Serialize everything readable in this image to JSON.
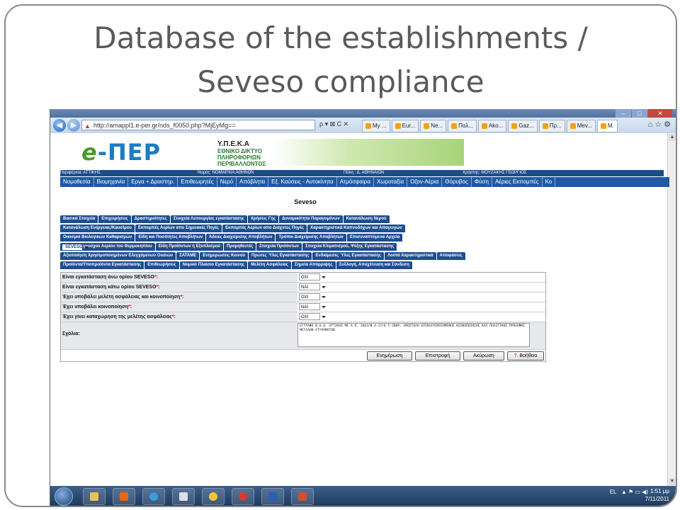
{
  "slide": {
    "title_line1": "Database of the establishments /",
    "title_line2": "Seveso compliance"
  },
  "browser": {
    "url": "http://amappl1.e-per.gr/nds_f0050.php?MjEyMg==",
    "tools": "ρ ▾ ⊠ C ✕",
    "tabs": [
      "My ...",
      "Eur...",
      "Ne...",
      "Πολ...",
      "Ako...",
      "Gaz...",
      "Πρ...",
      "Mev...",
      "M."
    ],
    "right_icons": "⌂ ☆ ⚙"
  },
  "site": {
    "logo_prefix": "e",
    "logo_text": "-ΠΕΡ",
    "org_name": "Υ.Π.Ε.Κ.Α",
    "org_line1": "ΕΘΝΙΚΟ ΔΙΚΤΥΟ",
    "org_line2": "ΠΛΗΡΟΦΟΡΙΩΝ",
    "org_line3": "ΠΕΡΙΒΑΛΛΟΝΤΟΣ",
    "info": {
      "region": "Περιφέρεια: ΑΤΤΙΚΗΣ",
      "prefecture": "Νομός: ΝΟΜΑΡΧΙΑ ΑΘΗΝΩΝ",
      "city": "Πόλη : Δ. ΑΘΗΝΑΙΩΝ",
      "user": "Χρήστης: ΜΟΥΖΑΚΗΣ ΓΕΩΡΓΙΟΣ"
    },
    "menu": [
      "Νομοθεσία",
      "Βιομηχανία",
      "Εργα + Δραστηρ.",
      "Επιθεωρητές",
      "Νερό",
      "Απόβλητα",
      "Εξ. Καύσεις - Αυτοκίνητα",
      "Ατμόσφαιρα",
      "Χωροταξία",
      "Οζον-Αέρια",
      "Θόρυβος",
      "Φύση",
      "Αέριες Εκπομπές",
      "Κο"
    ]
  },
  "page": {
    "heading": "Seveso",
    "tab_rows": [
      [
        "Βασικά Στοιχεία",
        "Επιχειρήσεις",
        "Δραστηριότητες",
        "Στοιχεία Λειτουργίας εγκατάστασης",
        "Χρήσεις Γης",
        "Δυναμικότητα Παραγομένων",
        "Κατανάλωση Νερού"
      ],
      [
        "Κατανάλωση Ενέργειας/Καυσίμου",
        "Εκπομπές Αερίων απο Σημειακές Πηγές",
        "Εκπομπές Αερίων απο Διάχυτες Πηγές",
        "Χαρακτηριστικά Καπνοδόχων και Απαγωγών"
      ],
      [
        "Οικισμοί Βιολογικών Καθαρισμών",
        "Είδη και Ποσότητες Αποβλήτων",
        "Άδειες Διαχείρισης Αποβλήτων",
        "Τρόποι Διαχείρισης Αποβλήτων",
        "Επισυναπτόμενα Αρχεία"
      ],
      [
        "SEVESO",
        "Είδος Φθοριούχου Αερίου του Θερμοκηπίου",
        "Είδη Προϊόντων ή Εξοπλισμού",
        "Προμηθευτές",
        "Στοιχεία Προϊόντων",
        "Στοιχεία Κλιματισμού, Ψύξης Εγκατάστασης"
      ],
      [
        "Αξιοποίηση Χρησιμοποιημένων Ελεγχόμενων Ουσιών",
        "ΣΑΤΑΜΕ",
        "Ενημερώσεις Κοινού",
        "Πρώτες Ύλες Εγκατάστασης",
        "Ενδιάμεσες Ύλες Εγκατάστασης",
        "Λοιπά Χαρακτηριστικά",
        "Αποφάσεις"
      ],
      [
        "Προϊόντα/Υποπροϊόντα Εγκατάστασης",
        "Επιθεωρήσεις",
        "Νομικό Πλαίσιο Εγκατάστασης",
        "Μελέτη Ασφάλειας",
        "Σημεία Απόρριψης",
        "Συλλογή, Αποχέτευση και Σύνδεση"
      ]
    ],
    "fields": [
      {
        "label": "Είναι εγκατάσταση άνω ορίου SEVESO",
        "value": "ΟΧΙ"
      },
      {
        "label": "Είναι εγκατάσταση κάτω ορίου SEVESO",
        "value": "ΝΑΙ"
      },
      {
        "label": "Έχει υποβάλει μελέτη ασφάλειας και κοινοποίηση",
        "value": "ΟΧΙ"
      },
      {
        "label": "Έχει υποβάλει κοινοποίηση",
        "value": "ΝΑΙ"
      },
      {
        "label": "Έχει γίνει καταχώρηση της μελέτης ασφάλειας",
        "value": "ΟΧΙ"
      }
    ],
    "required_mark": "*",
    "label_suffix": ":",
    "comments_label": "Σχόλια:",
    "comments_text": "ΕΓΓΡΑΦΟ Ν.Α.Δ. ΑΤΤΙΚΗΣ ΜΕ Α.Π. 2063/Φ.4-17/6-5-2009, ΑΠΟΣΤΟΛΗ ΕΠΙΚΑΙΡΟΠΟΙΗΜΕΝΗΣ ΚΟΙΝΟΠΟΙΗΣΗΣ ΚΑΙ ΠΟΛΙΤΙΚΗΣ ΠΡΟΛΗΨΗΣ ΜΕΓΑΛΩΝ ΑΤΥΧΗΜΑΤΩΝ",
    "buttons": {
      "update": "Ενημέρωση",
      "back": "Επιστροφή",
      "cancel": "Ακύρωση",
      "help": "Βοήθεια"
    }
  },
  "taskbar": {
    "lang": "EL",
    "time": "1:51 μμ",
    "date": "7/11/2011",
    "tray_icons": "▲ ⚑ ▭ ◀)"
  }
}
